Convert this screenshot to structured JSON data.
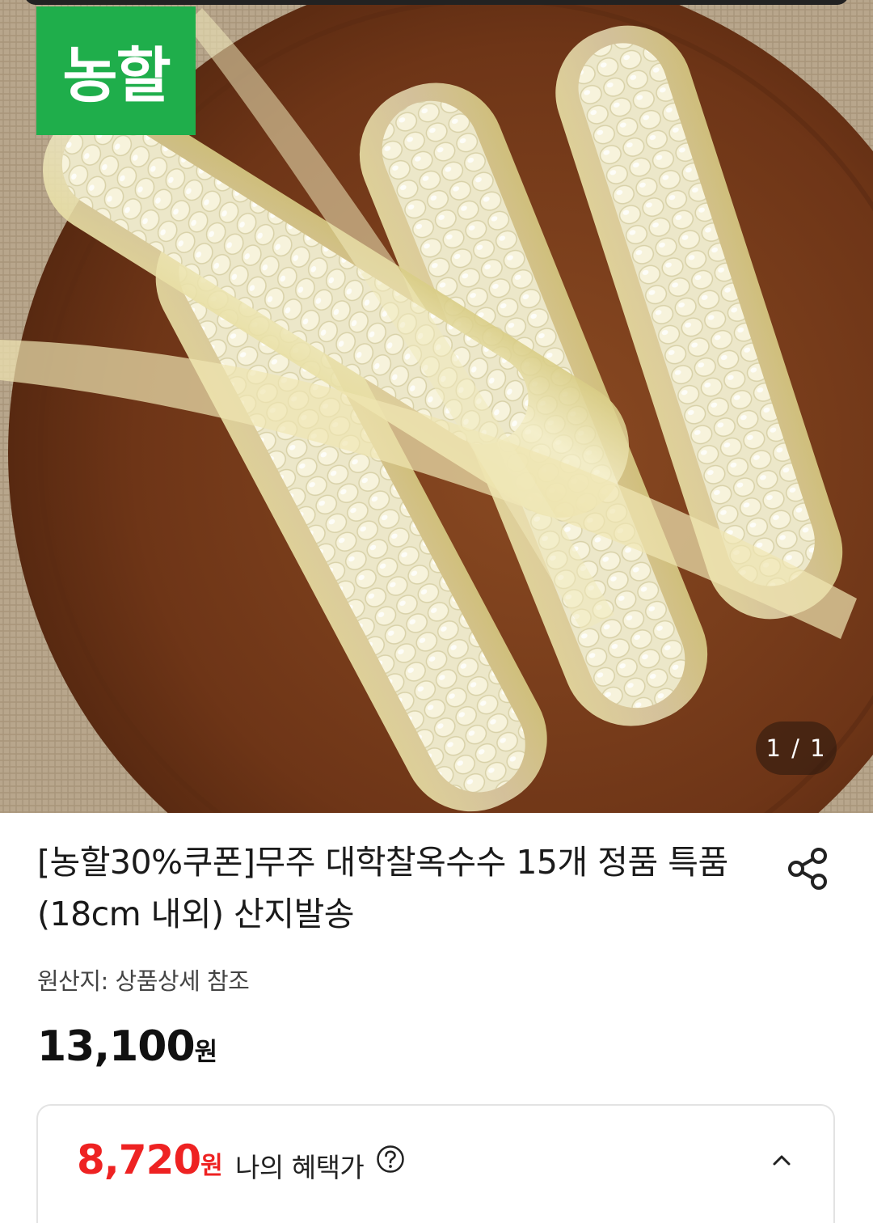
{
  "badge": {
    "text": "농할"
  },
  "gallery": {
    "counter": "1 / 1"
  },
  "product": {
    "title": "[농할30%쿠폰]무주 대학찰옥수수 15개 정품 특품(18cm 내외) 산지발송",
    "origin": "원산지: 상품상세 참조",
    "price": "13,100",
    "price_unit": "원"
  },
  "benefit": {
    "price": "8,720",
    "price_unit": "원",
    "label": "나의 혜택가"
  },
  "icons": {
    "share": "share-icon",
    "help": "question-circle-icon",
    "collapse": "chevron-up-icon"
  },
  "colors": {
    "badge_green": "#1fae4b",
    "benefit_red": "#ee2222"
  }
}
